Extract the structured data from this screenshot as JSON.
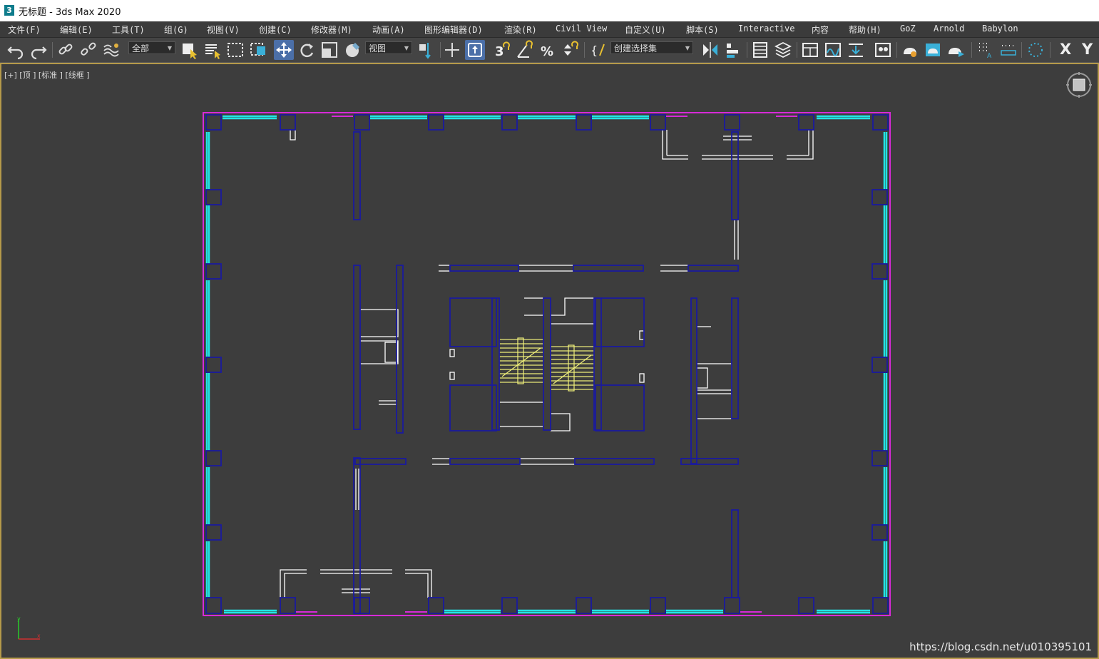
{
  "window": {
    "title": "无标题 - 3ds Max 2020",
    "app_icon_label": "3"
  },
  "menubar": {
    "items": [
      "文件(F)",
      "编辑(E)",
      "工具(T)",
      "组(G)",
      "视图(V)",
      "创建(C)",
      "修改器(M)",
      "动画(A)",
      "图形编辑器(D)",
      "渲染(R)",
      "Civil View",
      "自定义(U)",
      "脚本(S)",
      "Interactive",
      "内容",
      "帮助(H)",
      "GoZ",
      "Arnold",
      "Babylon"
    ]
  },
  "toolbar": {
    "selection_filter": "全部",
    "reference_coord": "视图",
    "named_selection_placeholder": "创建选择集",
    "axis_x": "X",
    "axis_y": "Y",
    "icons": [
      "undo-icon",
      "redo-icon",
      "link-icon",
      "unlink-icon",
      "bind-spacewarp-icon",
      "select-icon",
      "select-by-name-icon",
      "rect-region-icon",
      "window-crossing-icon",
      "move-icon",
      "rotate-icon",
      "scale-icon",
      "reference-coord-icon",
      "pivot-icon",
      "keyboard-shortcut-icon",
      "snap-3d-icon",
      "angle-snap-icon",
      "percent-snap-icon",
      "spinner-snap-icon",
      "edit-named-sel-icon",
      "mirror-icon",
      "align-icon",
      "scene-explorer-icon",
      "layer-explorer-icon",
      "toggle-ribbon-icon",
      "curve-editor-icon",
      "schematic-view-icon",
      "material-editor-icon",
      "render-setup-icon",
      "rendered-frame-icon",
      "render-icon"
    ]
  },
  "viewport": {
    "label": "[+] [顶 ] [标准 ] [线框 ]",
    "axis_labels": {
      "y": "y",
      "x": "x"
    },
    "colors": {
      "column": "#1a1a9e",
      "window": "#21e5e5",
      "wall": "#ffffff",
      "stair": "#f0f07a",
      "magenta": "#d82ad8"
    }
  },
  "watermark": "https://blog.csdn.net/u010395101"
}
